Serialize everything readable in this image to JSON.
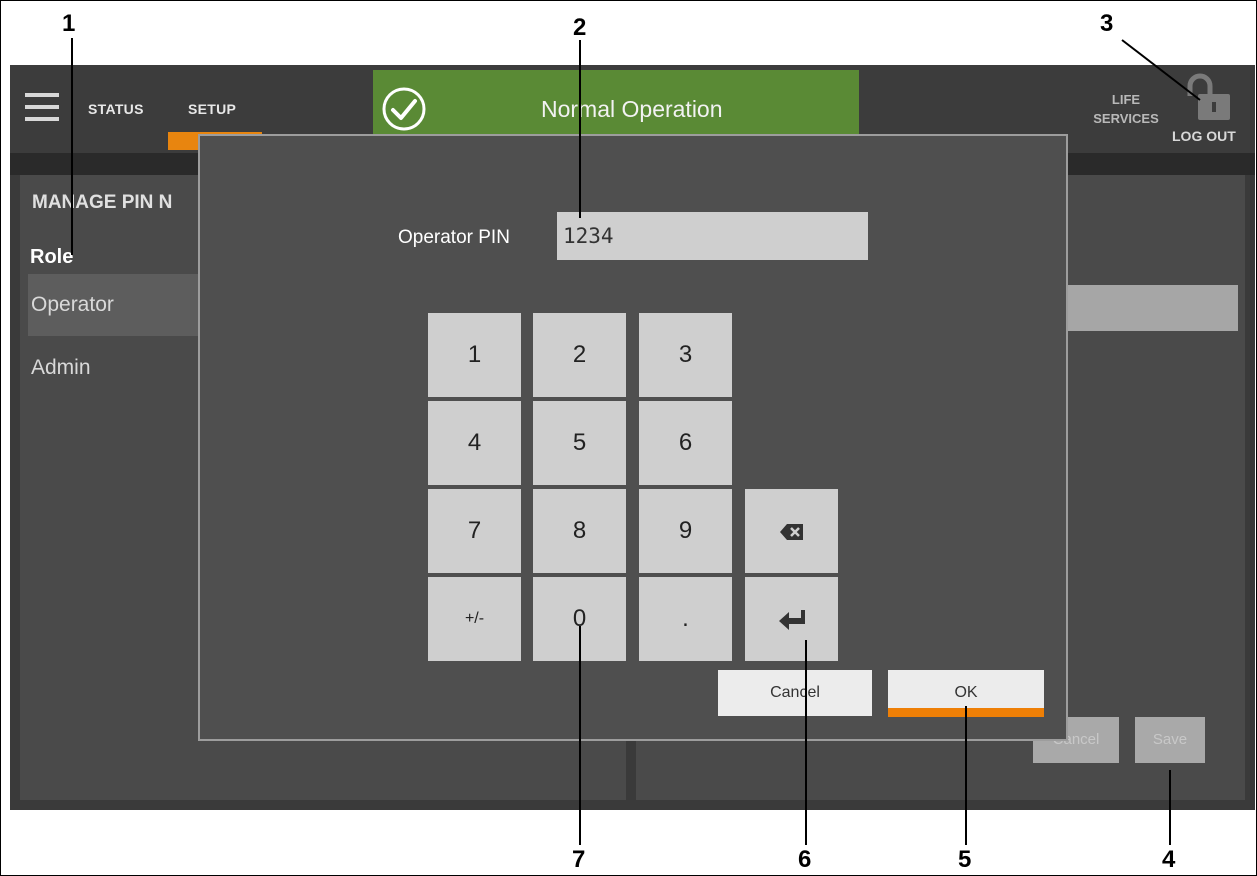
{
  "topbar": {
    "nav_status": "STATUS",
    "nav_setup": "SETUP",
    "banner_text": "Normal Operation",
    "life_services_line1": "LIFE",
    "life_services_line2": "SERVICES",
    "logout_label": "LOG OUT"
  },
  "left_panel": {
    "title": "MANAGE PIN N",
    "role_header": "Role",
    "roles": [
      "Operator",
      "Admin"
    ]
  },
  "right_panel": {
    "cancel_label": "Cancel",
    "save_label": "Save"
  },
  "dialog": {
    "pin_label": "Operator PIN",
    "pin_value": "1234",
    "keys": {
      "k1": "1",
      "k2": "2",
      "k3": "3",
      "k4": "4",
      "k5": "5",
      "k6": "6",
      "k7": "7",
      "k8": "8",
      "k9": "9",
      "plusminus": "+/-",
      "k0": "0",
      "dot": "."
    },
    "cancel_label": "Cancel",
    "ok_label": "OK"
  },
  "callouts": [
    "1",
    "2",
    "3",
    "4",
    "5",
    "6",
    "7"
  ],
  "colors": {
    "banner_green": "#5a8a35",
    "accent_orange": "#ee7f06"
  }
}
